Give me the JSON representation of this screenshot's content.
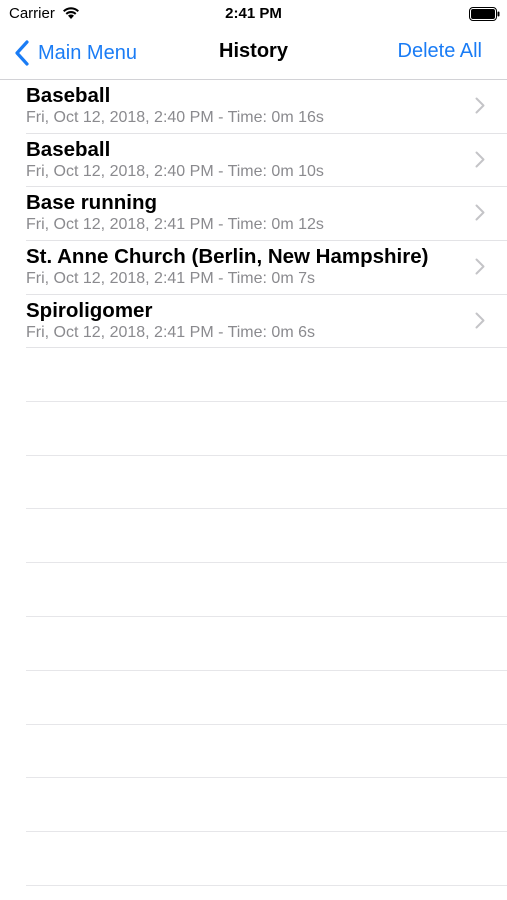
{
  "status_bar": {
    "carrier": "Carrier",
    "time": "2:41 PM",
    "icons": [
      "wifi-icon",
      "battery-icon"
    ]
  },
  "nav": {
    "back_label": "Main Menu",
    "title": "History",
    "action_label": "Delete All",
    "accent_color": "#1a7cf5"
  },
  "history": [
    {
      "title": "Baseball",
      "subtitle": "Fri, Oct 12, 2018, 2:40 PM - Time: 0m 16s"
    },
    {
      "title": "Baseball",
      "subtitle": "Fri, Oct 12, 2018, 2:40 PM - Time: 0m 10s"
    },
    {
      "title": "Base running",
      "subtitle": "Fri, Oct 12, 2018, 2:41 PM - Time: 0m 12s"
    },
    {
      "title": "St. Anne Church (Berlin, New Hampshire)",
      "subtitle": "Fri, Oct 12, 2018, 2:41 PM - Time: 0m 7s"
    },
    {
      "title": "Spiroligomer",
      "subtitle": "Fri, Oct 12, 2018, 2:41 PM - Time: 0m 6s"
    }
  ]
}
